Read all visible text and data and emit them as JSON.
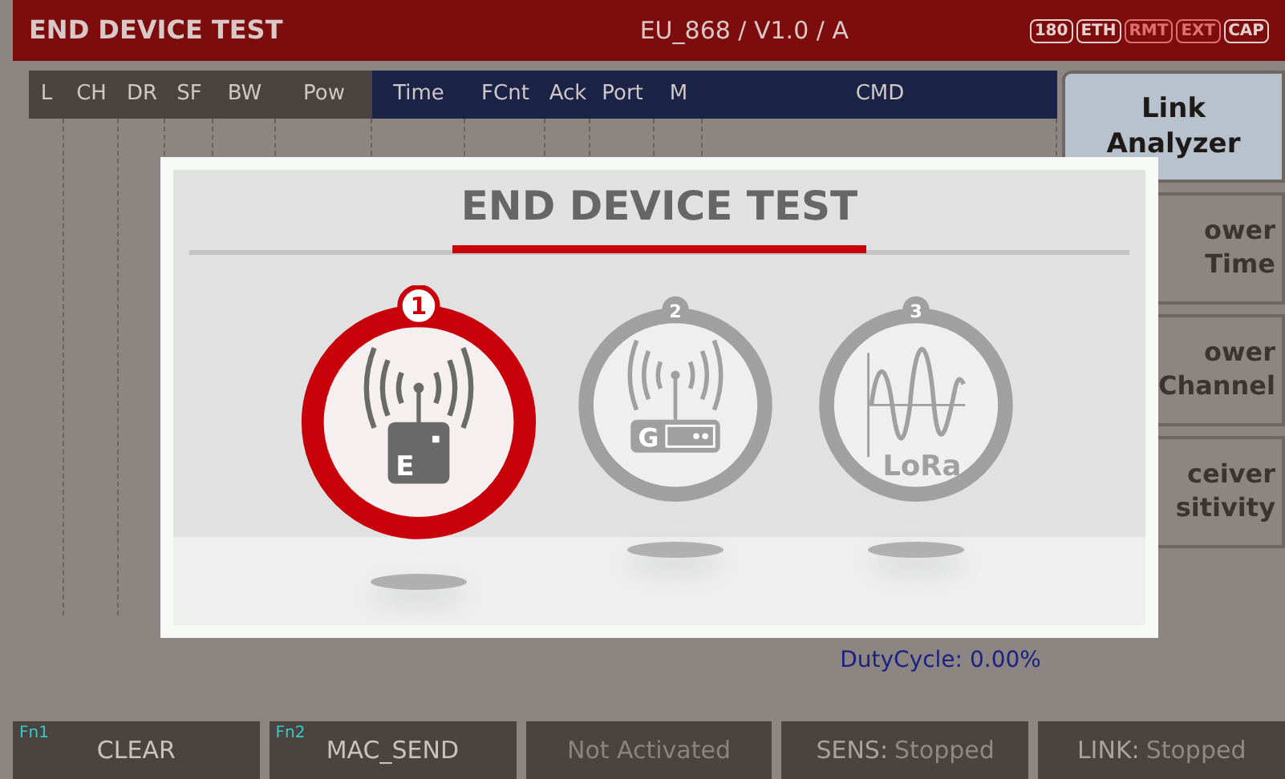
{
  "title_bar": {
    "title": "END DEVICE TEST",
    "region": "EU_868 / V1.0 / A",
    "indicators": [
      {
        "label": "180",
        "on": true
      },
      {
        "label": "ETH",
        "on": true
      },
      {
        "label": "RMT",
        "on": false
      },
      {
        "label": "EXT",
        "on": false
      },
      {
        "label": "CAP",
        "on": true
      }
    ]
  },
  "table": {
    "columns": [
      {
        "label": "L",
        "kind": "radio"
      },
      {
        "label": "CH",
        "kind": "radio"
      },
      {
        "label": "DR",
        "kind": "radio"
      },
      {
        "label": "SF",
        "kind": "radio"
      },
      {
        "label": "BW",
        "kind": "radio"
      },
      {
        "label": "Pow",
        "kind": "radio"
      },
      {
        "label": "Time",
        "kind": "frame"
      },
      {
        "label": "FCnt",
        "kind": "frame"
      },
      {
        "label": "Ack",
        "kind": "frame"
      },
      {
        "label": "Port",
        "kind": "frame"
      },
      {
        "label": "M",
        "kind": "frame"
      },
      {
        "label": "CMD",
        "kind": "frame"
      }
    ]
  },
  "readout": "DutyCycle: 0.00%",
  "side_buttons": [
    {
      "lines": [
        "Link",
        "Analyzer"
      ],
      "selected": true
    },
    {
      "lines": [
        "ower",
        "Time"
      ],
      "selected": false
    },
    {
      "lines": [
        "ower",
        "Channel"
      ],
      "selected": false
    },
    {
      "lines": [
        "ceiver",
        "sitivity"
      ],
      "selected": false
    }
  ],
  "function_keys": [
    {
      "key": "Fn1",
      "label": "CLEAR",
      "disabled": false
    },
    {
      "key": "Fn2",
      "label": "MAC_SEND",
      "disabled": false
    },
    {
      "label": "Not Activated",
      "disabled": true
    },
    {
      "label": "SENS:",
      "value": "Stopped",
      "disabled": true
    },
    {
      "label": "LINK:",
      "value": "Stopped",
      "disabled": true
    }
  ],
  "dialog": {
    "title": "END DEVICE TEST",
    "options": [
      {
        "number": "1",
        "kind": "end-device",
        "letter": "E",
        "selected": true
      },
      {
        "number": "2",
        "kind": "gateway",
        "letter": "G",
        "selected": false
      },
      {
        "number": "3",
        "kind": "lora",
        "label": "LoRa",
        "selected": false
      }
    ]
  }
}
